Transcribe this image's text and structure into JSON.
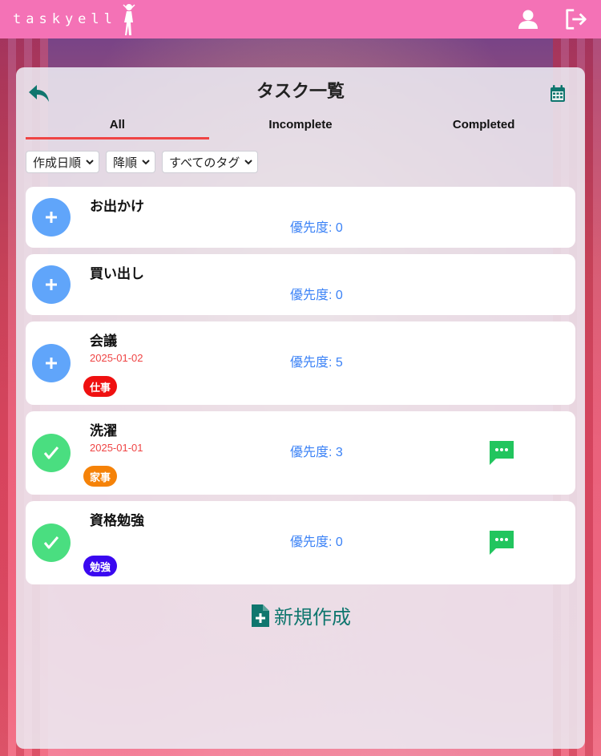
{
  "header": {
    "logo_text": "taskyell",
    "profile_icon": "user-icon",
    "logout_icon": "logout-icon"
  },
  "page": {
    "title": "タスク一覧",
    "back_icon": "back-arrow-icon",
    "calendar_icon": "calendar-icon"
  },
  "tabs": [
    {
      "label": "All",
      "active": true
    },
    {
      "label": "Incomplete",
      "active": false
    },
    {
      "label": "Completed",
      "active": false
    }
  ],
  "filters": {
    "sort_key": "作成日順",
    "sort_order": "降順",
    "tag": "すべてのタグ"
  },
  "tasks": [
    {
      "name": "お出かけ",
      "date": "",
      "priority": "優先度: 0",
      "tag": "",
      "status": "incomplete",
      "comment": false
    },
    {
      "name": "買い出し",
      "date": "",
      "priority": "優先度: 0",
      "tag": "",
      "status": "incomplete",
      "comment": false
    },
    {
      "name": "会議",
      "date": "2025-01-02",
      "priority": "優先度: 5",
      "tag": "仕事",
      "tag_color": "#ef1010",
      "status": "incomplete",
      "comment": false
    },
    {
      "name": "洗濯",
      "date": "2025-01-01",
      "priority": "優先度: 3",
      "tag": "家事",
      "tag_color": "#f58208",
      "status": "completed",
      "comment": true
    },
    {
      "name": "資格勉強",
      "date": "",
      "priority": "優先度: 0",
      "tag": "勉強",
      "tag_color": "#3a08f0",
      "status": "completed",
      "comment": true
    }
  ],
  "new_button": {
    "label": "新規作成"
  },
  "colors": {
    "header": "#f472b6",
    "accent_underline": "#ef4444",
    "add_circle": "#60a5fa",
    "done_circle": "#4ade80",
    "priority_text": "#3b82f6",
    "date_text": "#ef4444",
    "new_button": "#0f766e",
    "comment_icon": "#22c55e"
  }
}
